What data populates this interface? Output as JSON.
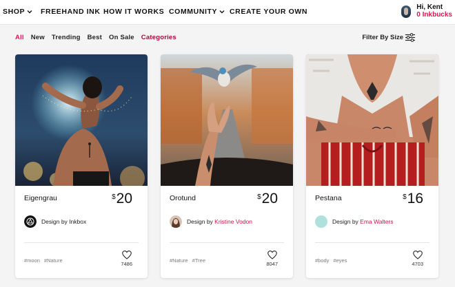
{
  "nav": {
    "items": [
      "SHOP",
      "FREEHAND INK",
      "HOW IT WORKS",
      "COMMUNITY",
      "CREATE YOUR OWN"
    ],
    "greeting": "Hi, Kent",
    "inkbucks": "0 Inkbucks"
  },
  "filters": {
    "tabs": [
      "All",
      "New",
      "Trending",
      "Best",
      "On Sale",
      "Categories"
    ],
    "size_label": "Filter By Size"
  },
  "products": [
    {
      "name": "Eigengrau",
      "currency": "$",
      "price": "20",
      "designer_prefix": "Design by ",
      "designer": "Inkbox",
      "tags": [
        "#moon",
        "#Nature"
      ],
      "likes": "7486"
    },
    {
      "name": "Orotund",
      "currency": "$",
      "price": "20",
      "designer_prefix": "Design by ",
      "designer": "Kristine Vodon",
      "tags": [
        "#Nature",
        "#Tree"
      ],
      "likes": "8047"
    },
    {
      "name": "Pestana",
      "currency": "$",
      "price": "16",
      "designer_prefix": "Design by ",
      "designer": "Ema Walters",
      "tags": [
        "#body",
        "#eyes"
      ],
      "likes": "4703"
    }
  ],
  "colors": {
    "accent": "#d81a4f",
    "accent_dark": "#a10d3a",
    "designer_link": "#c2184b",
    "page_bg": "#f4f4f5"
  },
  "icons": {
    "nav_dropdown": "chevron-down-icon",
    "filter_size": "sliders-icon",
    "like": "heart-icon",
    "inkbox_logo": "inkbox-logo-icon"
  }
}
